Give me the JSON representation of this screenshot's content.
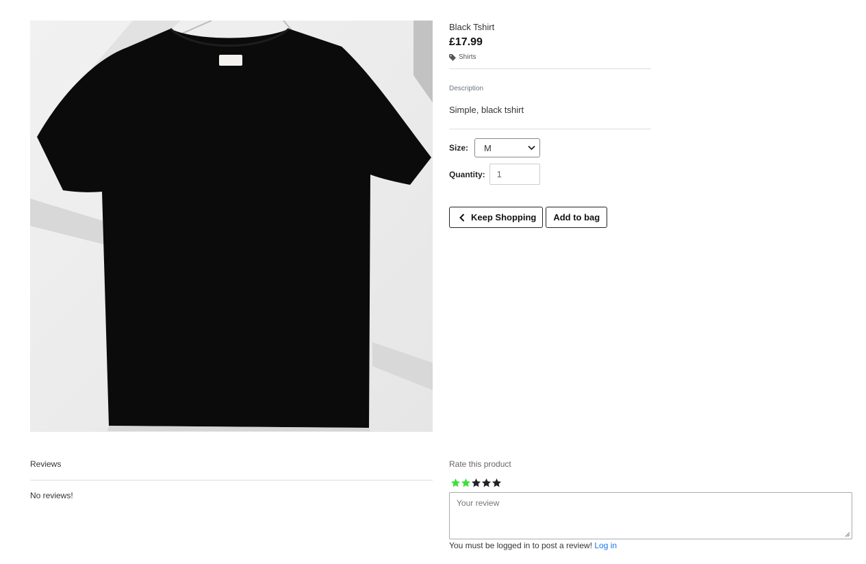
{
  "product": {
    "name": "Black Tshirt",
    "price": "£17.99",
    "category": "Shirts",
    "description_label": "Description",
    "description": "Simple, black tshirt",
    "image_icon": "tshirt-photo"
  },
  "form": {
    "size_label": "Size:",
    "size_value": "M",
    "quantity_label": "Quantity:",
    "quantity_value": "1"
  },
  "buttons": {
    "keep_shopping": "Keep Shopping",
    "add_to_bag": "Add to bag"
  },
  "reviews": {
    "heading": "Reviews",
    "empty_text": "No reviews!"
  },
  "rating": {
    "heading": "Rate this product",
    "selected": 2,
    "max": 5,
    "active_color": "#3de03d",
    "inactive_color": "#222222"
  },
  "review_form": {
    "placeholder": "Your review",
    "login_note": "You must be logged in to post a review!",
    "login_link": "Log in"
  },
  "colors": {
    "link": "#1a73e8"
  }
}
